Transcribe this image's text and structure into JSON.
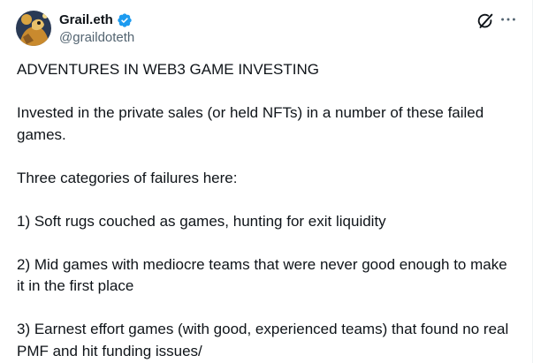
{
  "author": {
    "display_name": "Grail.eth",
    "handle": "@graildoteth",
    "verified": true,
    "verified_color": "#1d9bf0"
  },
  "icons": {
    "verified": "verified-badge-icon",
    "grok": "grok-icon",
    "more": "more-options-icon"
  },
  "post": {
    "paragraphs": [
      "ADVENTURES IN WEB3 GAME INVESTING",
      "Invested in the private sales (or held NFTs) in a number of these failed games.",
      "Three categories of failures here:",
      "1) Soft rugs couched as games, hunting for exit liquidity",
      "2) Mid games with mediocre teams that were never good enough to make it in the first place",
      "3) Earnest effort games (with good, experienced teams) that found no real PMF and hit funding issues/"
    ]
  },
  "colors": {
    "text": "#0f1419",
    "secondary": "#536471",
    "accent": "#1d9bf0"
  }
}
